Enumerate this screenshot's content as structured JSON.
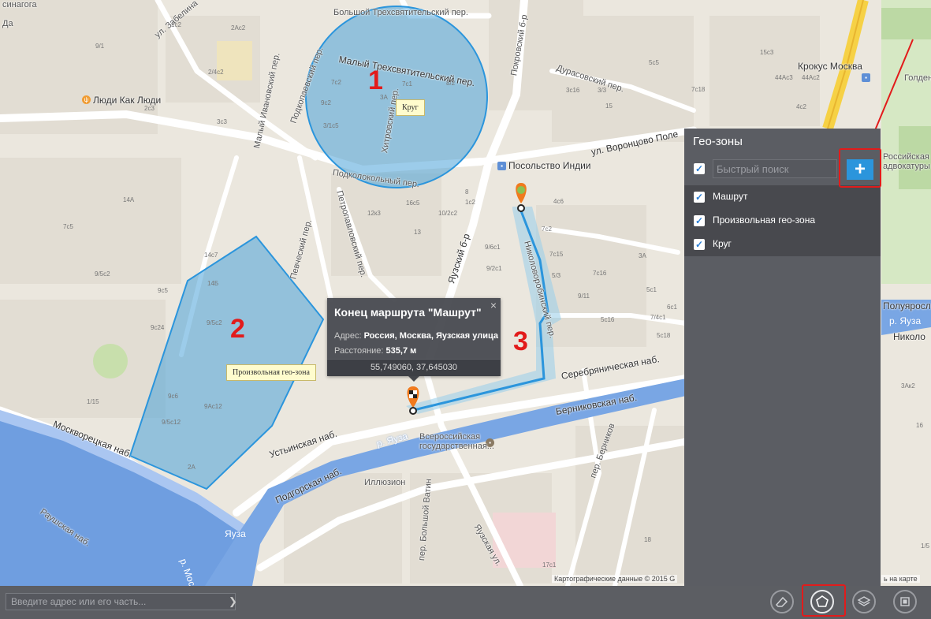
{
  "map": {
    "streets": [
      "Большой Трехсвятительский пер.",
      "Малый Трехсвятительский пер.",
      "ул. Забелина",
      "Покровский б-р",
      "Дурасовский пер.",
      "ул. Воронцово Поле",
      "Подколокольный пер.",
      "Хитровский пер.",
      "Подкопаевский пер.",
      "Малый Ивановский пер.",
      "Певческий пер.",
      "Петропавловский пер.",
      "Яузский б-р",
      "Николоворобинский пер.",
      "Серебряническая наб.",
      "Берниковская наб.",
      "Москворецкая наб.",
      "Устьинская наб.",
      "р. Яуза",
      "Подгорская наб.",
      "Раушская наб.",
      "р. Москва",
      "Яуза",
      "пер. Берников",
      "пер. Большой Ватин",
      "Яузская ул.",
      "Полуяросл",
      "Николо",
      "Кро­кус Москва",
      "Голден",
      "Российская адвокатуры и"
    ],
    "places": [
      "Посольство Индии",
      "Люди Как Люди",
      "Всероссийская государственная...",
      "Иллюзион",
      "синагога",
      "Да",
      "Крокус Москва",
      "Российская",
      "адвокатуры и",
      "Голден",
      "Полуяросл",
      "Николо",
      "р. Яуза",
      "ь на карте"
    ],
    "house_numbers": [
      "2Ас2",
      "1с2",
      "9/1",
      "2/4с2",
      "2с3",
      "3с3",
      "14А",
      "7с5",
      "9/5с2",
      "9с5",
      "9с24",
      "1/15",
      "9с6",
      "9/5с12",
      "9Ас12",
      "2А",
      "14с7",
      "14Б",
      "9/5с2",
      "7с2",
      "3/1с5",
      "9с2",
      "3А",
      "8/2",
      "7с1",
      "12к3",
      "16с5",
      "13",
      "1с2",
      "10/2с2",
      "8",
      "9/6с1",
      "9/2с1",
      "4с6",
      "7с2",
      "7с15",
      "5/3",
      "9/11",
      "5с1",
      "7с16",
      "15",
      "3с16",
      "3/3",
      "5с5",
      "7с18",
      "3А",
      "5с16",
      "5с18",
      "6с1",
      "7/4с1",
      "44Ас3",
      "44Ас2",
      "15с3",
      "4с2",
      "3Ак2",
      "16",
      "17с1",
      "18",
      "1/5"
    ],
    "zones": [
      {
        "number": "1",
        "tooltip": "Круг"
      },
      {
        "number": "2",
        "tooltip": "Произвольная гео-зона"
      },
      {
        "number": "3",
        "tooltip": ""
      }
    ],
    "copyright": "Картографические данные © 2015 G",
    "copyright_right": "ь на карте"
  },
  "popup": {
    "title": "Конец маршрута \"Машрут\"",
    "close": "×",
    "address_label": "Адрес:",
    "address_value": "Россия, Москва, Яузская улица",
    "distance_label": "Расстояние:",
    "distance_value": "535,7 м",
    "coordinates": "55,749060, 37,645030"
  },
  "panel": {
    "title": "Гео-зоны",
    "search_placeholder": "Быстрый поиск",
    "add_label": "+",
    "items": [
      {
        "label": "Машрут",
        "checked": true
      },
      {
        "label": "Произвольная гео-зона",
        "checked": true
      },
      {
        "label": "Круг",
        "checked": true
      }
    ]
  },
  "bottombar": {
    "address_placeholder": "Введите адрес или его часть...",
    "go_icon": "chevron-right-icon",
    "tools": [
      "eraser-icon",
      "pentagon-icon",
      "layers-icon",
      "square-icon"
    ]
  },
  "colors": {
    "zone_fill": "#4aa3d8",
    "zone_stroke": "#2b95dc",
    "route": "#2b95dc",
    "panel_bg": "#5b5d63",
    "annotation_red": "#e21b1b"
  }
}
